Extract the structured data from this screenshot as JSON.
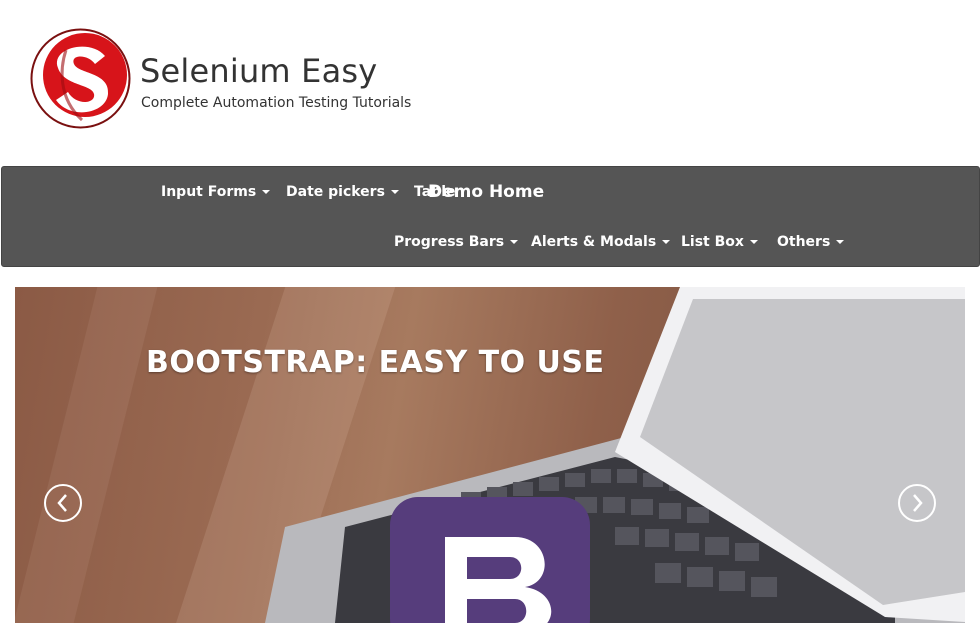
{
  "brand": {
    "title": "Selenium Easy",
    "tagline": "Complete Automation Testing Tutorials",
    "logo_icon": "selenium-easy-s-logo"
  },
  "navbar": {
    "row1": [
      {
        "label": "Input Forms"
      },
      {
        "label": "Date pickers"
      },
      {
        "label": "Table"
      }
    ],
    "demo_home": "Demo Home",
    "row2": [
      {
        "label": "Progress Bars"
      },
      {
        "label": "Alerts & Modals"
      },
      {
        "label": "List Box"
      },
      {
        "label": "Others"
      }
    ]
  },
  "carousel": {
    "caption": "BOOTSTRAP: EASY TO USE",
    "prev_icon": "chevron-left-icon",
    "next_icon": "chevron-right-icon",
    "bootstrap_logo_letter": "B"
  },
  "colors": {
    "navbar_bg": "#555555",
    "logo_red": "#d7141a",
    "bootstrap_purple": "#563d7c"
  }
}
